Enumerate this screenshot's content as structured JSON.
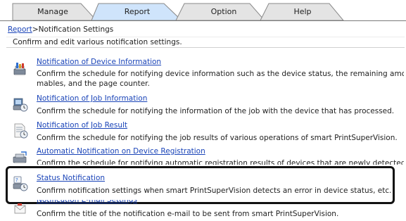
{
  "tabs": [
    {
      "label": "Manage",
      "active": false
    },
    {
      "label": "Report",
      "active": true
    },
    {
      "label": "Option",
      "active": false
    },
    {
      "label": "Help",
      "active": false
    }
  ],
  "breadcrumb": {
    "link": "Report",
    "rest": ">Notification Settings"
  },
  "subtitle": "Confirm and edit various notification settings.",
  "items": [
    {
      "icon": "device-info-icon",
      "title": "Notification of Device Information",
      "desc": "Confirm the schedule for notifying device information such as the device status, the remaining amount of consu",
      "desc2": "mables, and the page counter."
    },
    {
      "icon": "job-info-icon",
      "title": "Notification of Job Information",
      "desc": "Confirm the schedule for notifying the information of the job with the device that has processed."
    },
    {
      "icon": "job-result-icon",
      "title": "Notification of Job Result",
      "desc": "Confirm the schedule for notifying the job results of various operations of smart PrintSuperVision."
    },
    {
      "icon": "device-registration-icon",
      "title": "Automatic Notification on Device Registration",
      "desc": "Confirm the schedule for notifying automatic registration results of devices that are newly detected."
    },
    {
      "icon": "status-notification-icon",
      "title": "Status Notification",
      "desc": "Confirm notification settings when smart PrintSuperVision detects an error in device status, etc."
    },
    {
      "icon": "email-settings-icon",
      "title": "Notification E-mail Settings",
      "desc": "Confirm the title of the notification e-mail to be sent from smart PrintSuperVision."
    }
  ],
  "colors": {
    "link": "#1a44b8",
    "tab_active": "#cfe4fb",
    "tab_inactive": "#e4e4e4",
    "highlight": "#111111"
  }
}
